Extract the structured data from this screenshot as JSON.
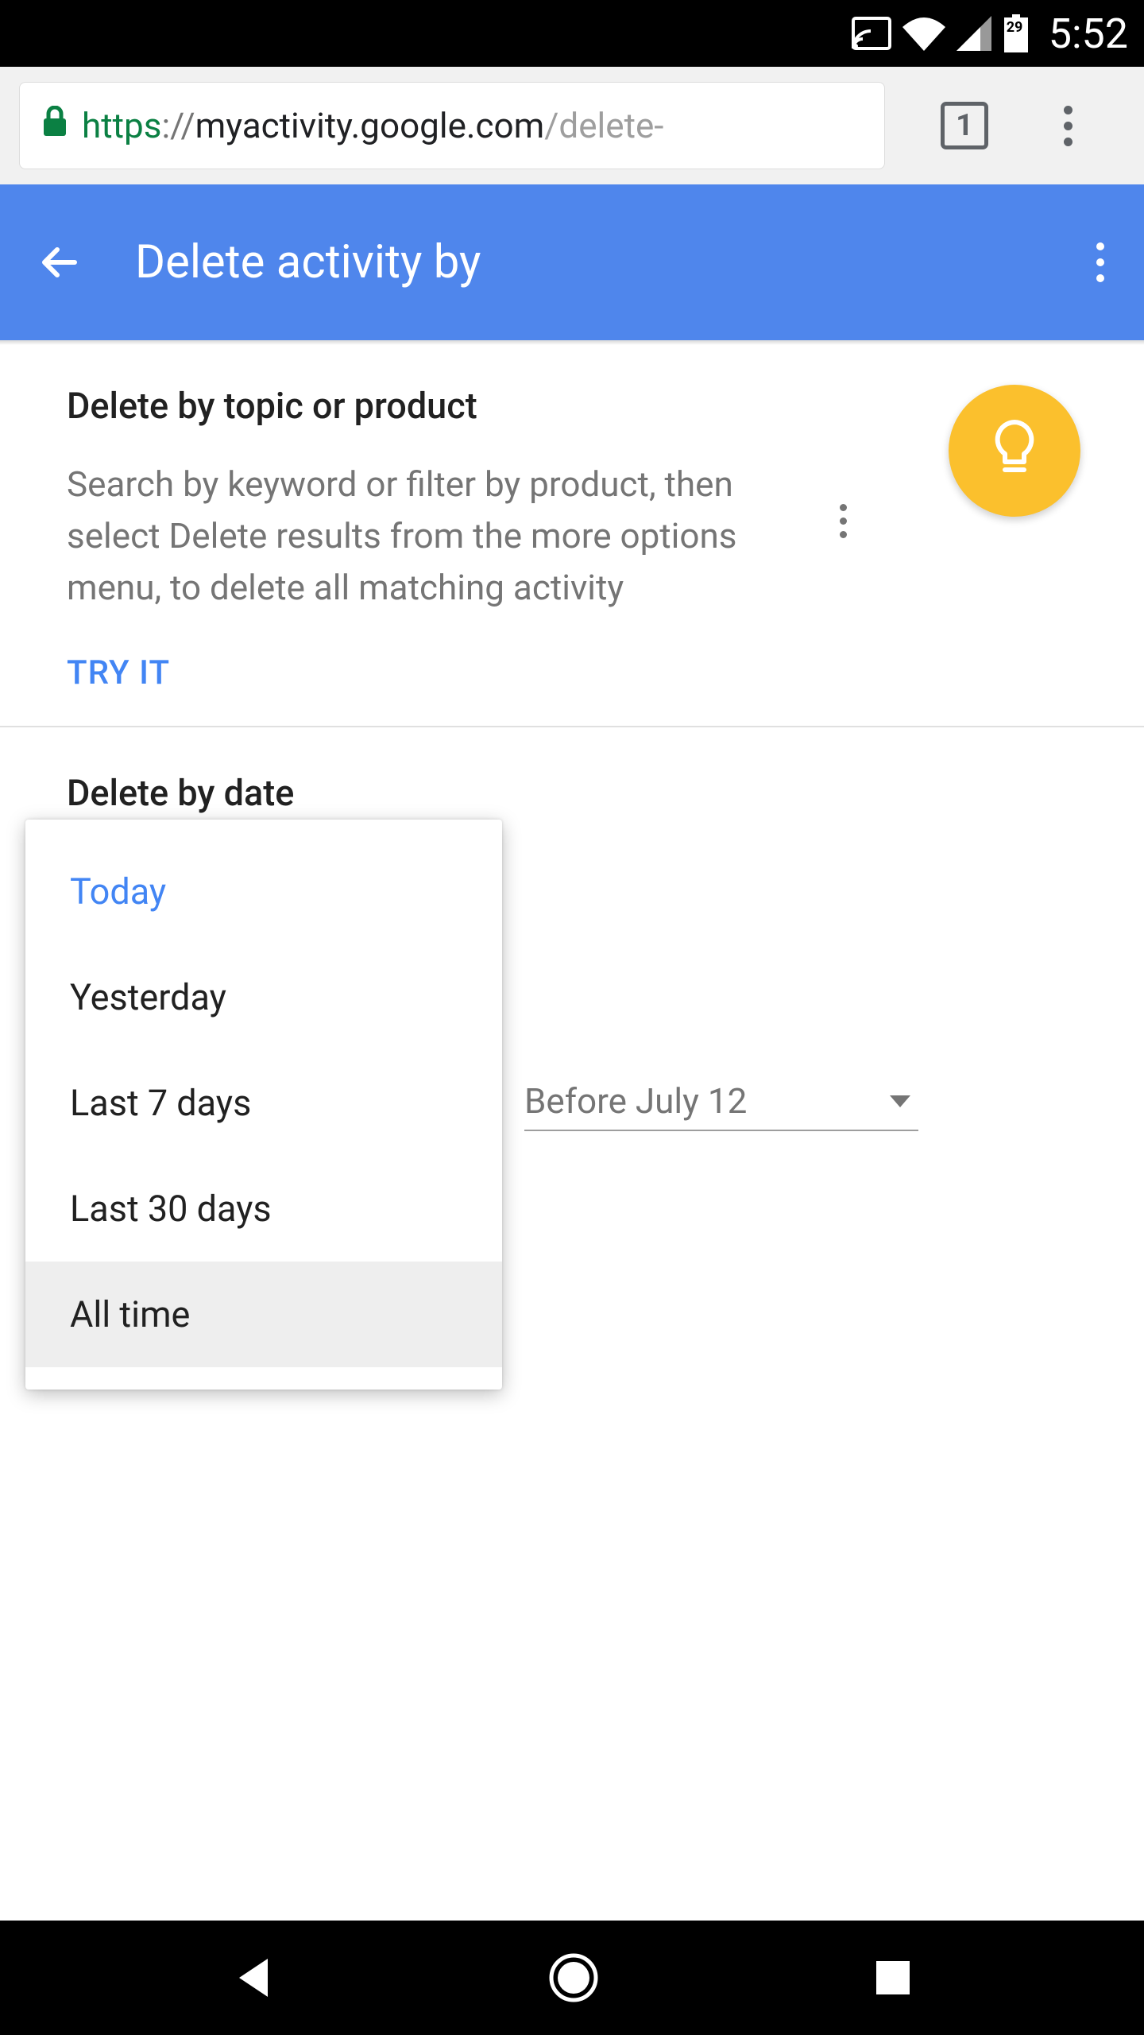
{
  "status_bar": {
    "time": "5:52",
    "battery_text": "29"
  },
  "browser": {
    "scheme": "https",
    "separator": "://",
    "host": "myactivity.google.com",
    "path": "/delete-",
    "tab_count": "1"
  },
  "header": {
    "title": "Delete activity by"
  },
  "topic_section": {
    "title": "Delete by topic or product",
    "description": "Search by keyword or filter by product, then select Delete results from the more options menu, to delete all matching activity",
    "try_it": "TRY IT"
  },
  "date_section": {
    "title": "Delete by date",
    "options": [
      {
        "label": "Today"
      },
      {
        "label": "Yesterday"
      },
      {
        "label": "Last 7 days"
      },
      {
        "label": "Last 30 days"
      },
      {
        "label": "All time"
      }
    ],
    "selected_option": "Today",
    "hovered_option": "All time",
    "before_label": "Before July 12"
  }
}
